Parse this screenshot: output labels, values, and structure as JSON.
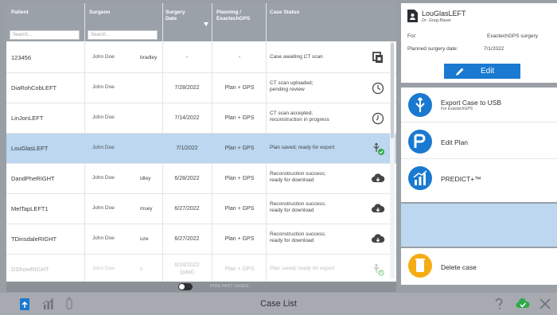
{
  "table": {
    "headers": {
      "patient": "Patient",
      "surgeon": "Surgeon",
      "surgery_date": [
        "Surgery",
        "Date"
      ],
      "planning": [
        "Planning /",
        "ExactechGPS"
      ],
      "case_status": "Case Status"
    },
    "filters": {
      "patient_placeholder": "Search...",
      "surgeon_placeholder": "Search..."
    },
    "rows": [
      {
        "patient": "123456",
        "surgeon": "John Doe",
        "extra": "bradley",
        "date": "-",
        "plan": "-",
        "status": [
          "Case awaiting CT scan"
        ],
        "icon": "copy-icon"
      },
      {
        "patient": "DiaRohCobLEFT",
        "surgeon": "John Doe",
        "extra": "",
        "date": "7/28/2022",
        "plan": "Plan + GPS",
        "status": [
          "CT scan uploaded;",
          "pending review"
        ],
        "icon": "clock-icon"
      },
      {
        "patient": "LinJonLEFT",
        "surgeon": "John Doe",
        "extra": "",
        "date": "7/14/2022",
        "plan": "Plan + GPS",
        "status": [
          "CT scan accepted;",
          "reconstruction in progress"
        ],
        "icon": "clock-icon"
      },
      {
        "patient": "LouGlasLEFT",
        "surgeon": "John Doe",
        "extra": "",
        "date": "7/1/2022",
        "plan": "Plan + GPS",
        "status": [
          "Plan saved; ready for export"
        ],
        "icon": "usb-check-icon"
      },
      {
        "patient": "DandPheRIGHT",
        "surgeon": "John Doe",
        "extra": "idley",
        "date": "6/28/2022",
        "plan": "Plan + GPS",
        "status": [
          "Reconstruction success;",
          "ready for download"
        ],
        "icon": "cloud-download-icon"
      },
      {
        "patient": "MelTapLEFT1",
        "surgeon": "John Doe",
        "extra": "msey",
        "date": "6/27/2022",
        "plan": "Plan + GPS",
        "status": [
          "Reconstruction success;",
          "ready for download"
        ],
        "icon": "cloud-download-icon"
      },
      {
        "patient": "TDinsdaleRIGHT",
        "surgeon": "John Doe",
        "extra": "uze",
        "date": "6/27/2022",
        "plan": "Plan + GPS",
        "status": [
          "Reconstruction success;",
          "ready for download"
        ],
        "icon": "cloud-download-icon"
      },
      {
        "patient": "DShowRIGHT",
        "surgeon": "John Doe",
        "extra": "n",
        "date": [
          "6/24/2022",
          "(past)"
        ],
        "plan": "Plan + GPS",
        "status": [
          "Plan saved; ready for export"
        ],
        "icon": "usb-check-icon"
      }
    ],
    "selected_index": 3,
    "hide_past_label": "HIDE PAST CASES"
  },
  "case_card": {
    "name": "LouGlasLEFT",
    "doctor": "Dr. Greg Bauer",
    "for_label": "For:",
    "for_value": "ExactechGPS surgery",
    "planned_label": "Planned surgery date:",
    "planned_value": "7/1/2022",
    "edit_label": "Edit"
  },
  "actions": [
    {
      "label": "Export Case to USB",
      "sub": "For ExactechGPS",
      "icon": "usb-icon"
    },
    {
      "label": "Edit Plan",
      "sub": "",
      "icon": "edit-plan-icon"
    },
    {
      "label": "PREDICT+™",
      "sub": "",
      "icon": "chart-icon"
    }
  ],
  "delete_label": "Delete case",
  "bottom": {
    "title": "Case List"
  },
  "colors": {
    "accent": "#1a79d0",
    "selected_row": "#bcd7ef",
    "delete": "#f3ac12",
    "success": "#2faa48"
  }
}
